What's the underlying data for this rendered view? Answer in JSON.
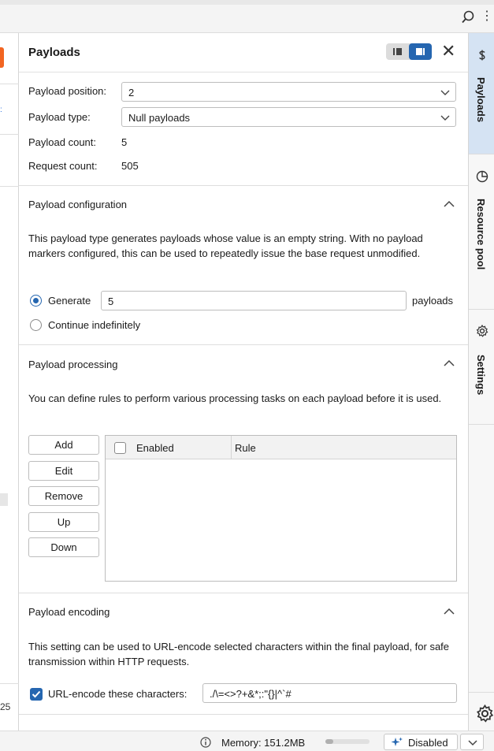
{
  "header": {
    "title": "Payloads",
    "close_icon": "close-icon"
  },
  "fields": {
    "payload_position_label": "Payload position:",
    "payload_position_value": "2",
    "payload_type_label": "Payload type:",
    "payload_type_value": "Null payloads",
    "payload_count_label": "Payload count:",
    "payload_count_value": "5",
    "request_count_label": "Request count:",
    "request_count_value": "505"
  },
  "config": {
    "title": "Payload configuration",
    "description": "This payload type generates payloads whose value is an empty string. With no payload markers configured, this can be used to repeatedly issue the base request unmodified.",
    "generate_label": "Generate",
    "generate_value": "5",
    "payloads_suffix": "payloads",
    "continue_label": "Continue indefinitely",
    "selected_option": "Generate"
  },
  "processing": {
    "title": "Payload processing",
    "description": "You can define rules to perform various processing tasks on each payload before it is used.",
    "buttons": [
      "Add",
      "Edit",
      "Remove",
      "Up",
      "Down"
    ],
    "columns": [
      "Enabled",
      "Rule"
    ]
  },
  "encoding": {
    "title": "Payload encoding",
    "description": "This setting can be used to URL-encode selected characters within the final payload, for safe transmission within HTTP requests.",
    "checkbox_label": "URL-encode these characters:",
    "checked": true,
    "characters": "./\\=<>?+&*;:\"{}|^`#"
  },
  "sidebar_tabs": [
    {
      "label": "Payloads",
      "icon": "dollar-icon",
      "active": true
    },
    {
      "label": "Resource pool",
      "icon": "pie-chart-icon",
      "active": false
    },
    {
      "label": "Settings",
      "icon": "gear-icon",
      "active": false
    }
  ],
  "left_strip": {
    "number": "25"
  },
  "status": {
    "memory": "Memory: 151.2MB",
    "memory_fraction": 0.18,
    "ai_label": "Disabled"
  },
  "colors": {
    "accent": "#2566b0",
    "brand_orange": "#f26522",
    "active_tab": "#d5e3f3"
  }
}
